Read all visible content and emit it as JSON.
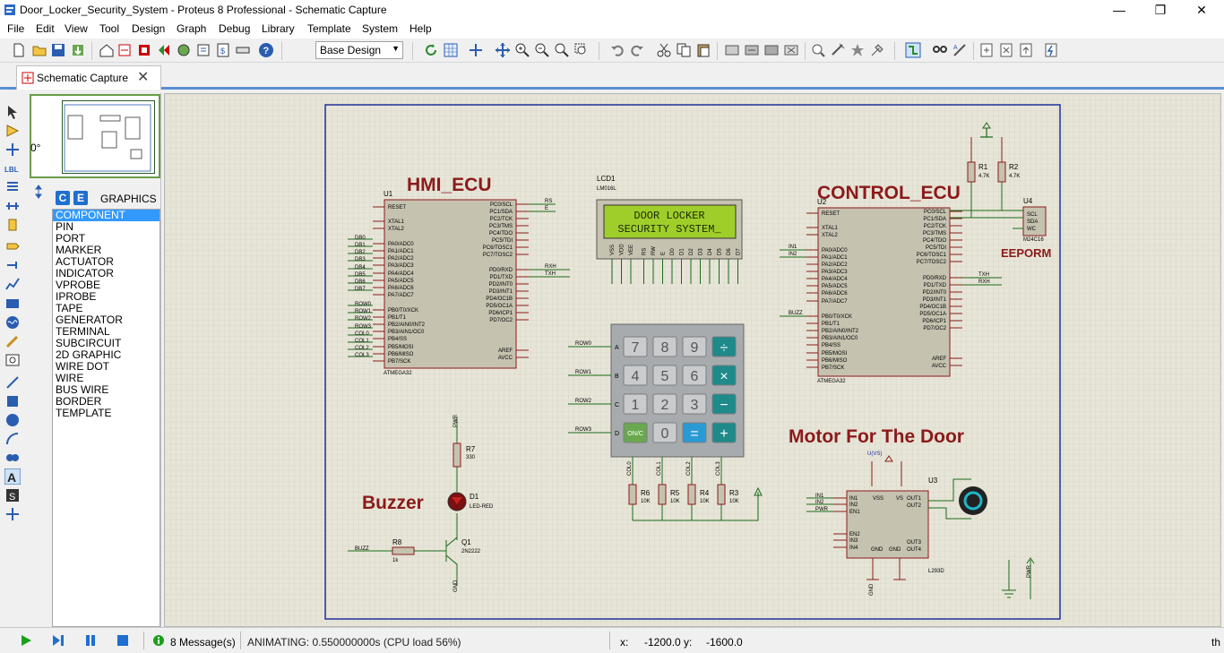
{
  "window": {
    "title": "Door_Locker_Security_System - Proteus 8 Professional - Schematic Capture",
    "minimize": "—",
    "restore": "❐",
    "close": "✕"
  },
  "menu": [
    "File",
    "Edit",
    "View",
    "Tool",
    "Design",
    "Graph",
    "Debug",
    "Library",
    "Template",
    "System",
    "Help"
  ],
  "toolbar": {
    "design_select": "Base Design",
    "accent_color": "#1e6fd0"
  },
  "tab": {
    "label": "Schematic Capture",
    "close": "✕"
  },
  "left_panel": {
    "rotation": "0°",
    "mode_tab_c": "C",
    "mode_tab_e": "E",
    "graphics_label": "GRAPHICS",
    "modes": [
      "COMPONENT",
      "PIN",
      "PORT",
      "MARKER",
      "ACTUATOR",
      "INDICATOR",
      "VPROBE",
      "IPROBE",
      "TAPE",
      "GENERATOR",
      "TERMINAL",
      "SUBCIRCUIT",
      "2D GRAPHIC",
      "WIRE DOT",
      "WIRE",
      "BUS WIRE",
      "BORDER",
      "TEMPLATE"
    ],
    "selected_mode": "COMPONENT"
  },
  "schematic": {
    "hmi_title": "HMI_ECU",
    "control_title": "CONTROL_ECU",
    "buzzer_title": "Buzzer",
    "motor_title": "Motor For The Door",
    "eeprom_title": "EEPORM",
    "u1_ref": "U1",
    "u1_part": "ATMEGA32",
    "u2_ref": "U2",
    "u2_part": "ATMEGA32",
    "u3_ref": "U3",
    "u3_part": "L293D",
    "u4_ref": "U4",
    "u4_part": "M24C16",
    "lcd_ref": "LCD1",
    "lcd_part": "LM016L",
    "lcd_line1": "DOOR LOCKER",
    "lcd_line2": "SECURITY SYSTEM_",
    "r1": "R1",
    "r1_val": "4.7K",
    "r2": "R2",
    "r2_val": "4.7K",
    "r3": "R3",
    "r3_val": "10K",
    "r4": "R4",
    "r4_val": "10K",
    "r5": "R5",
    "r5_val": "10K",
    "r6": "R6",
    "r6_val": "10K",
    "r7": "R7",
    "r7_val": "330",
    "r8": "R8",
    "r8_val": "1k",
    "d1": "D1",
    "d1_part": "LED-RED",
    "q1": "Q1",
    "q1_part": "2N2222",
    "u1_left_pins": [
      "RESET",
      "XTAL1",
      "XTAL2",
      "PA0/ADC0",
      "PA1/ADC1",
      "PA2/ADC2",
      "PA3/ADC3",
      "PA4/ADC4",
      "PA5/ADC5",
      "PA6/ADC6",
      "PA7/ADC7",
      "PB0/T0/XCK",
      "PB1/T1",
      "PB2/AIN0/INT2",
      "PB3/AIN1/OC0",
      "PB4/SS",
      "PB5/MOSI",
      "PB6/MISO",
      "PB7/SCK"
    ],
    "u1_right_pins": [
      "PC0/SCL",
      "PC1/SDA",
      "PC2/TCK",
      "PC3/TMS",
      "PC4/TDO",
      "PC5/TDI",
      "PC6/TOSC1",
      "PC7/TOSC2",
      "PD0/RXD",
      "PD1/TXD",
      "PD2/INT0",
      "PD3/INT1",
      "PD4/OC1B",
      "PD5/OC1A",
      "PD6/ICP1",
      "PD7/OC2",
      "AREF",
      "AVCC"
    ],
    "u1_nets": [
      "DB0",
      "DB1",
      "DB2",
      "DB3",
      "DB4",
      "DB5",
      "DB6",
      "DB7",
      "ROW0",
      "ROW1",
      "ROW2",
      "ROW3",
      "COL0",
      "COL1",
      "COL2",
      "COL3"
    ],
    "keypad_keys": [
      "7",
      "8",
      "9",
      "÷",
      "4",
      "5",
      "6",
      "×",
      "1",
      "2",
      "3",
      "−",
      "ON/C",
      "0",
      "=",
      "+"
    ],
    "keypad_rows": [
      "A",
      "B",
      "C",
      "D"
    ],
    "keypad_row_nets": [
      "ROW0",
      "ROW1",
      "ROW2",
      "ROW3"
    ],
    "keypad_cols": [
      "COL0",
      "COL1",
      "COL2",
      "COL3"
    ],
    "u2_left_nets": [
      "IN1",
      "IN2",
      "BUZZ"
    ],
    "u2_right_nets": [
      "TXH",
      "RXH"
    ],
    "u1_uart_nets": [
      "RXH",
      "TXH",
      "RS",
      "E"
    ],
    "l293_left": [
      "IN1",
      "IN2",
      "EN1",
      "EN2",
      "IN3",
      "IN4"
    ],
    "l293_nets": [
      "IN1",
      "IN2",
      "PWR"
    ],
    "l293_right": [
      "VSS",
      "VS",
      "OUT1",
      "OUT2",
      "GND",
      "GND",
      "OUT3",
      "OUT4"
    ],
    "buzz_net": "BUZZ",
    "pwr_label": "PWR",
    "gnd_label": "GND",
    "vss_label": "U(VS)"
  },
  "status": {
    "messages": "8 Message(s)",
    "animating": "ANIMATING: 0.550000000s (CPU load 56%)",
    "x_label": "x:",
    "x_value": "-1200.0",
    "y_label": "y:",
    "y_value": "-1600.0",
    "units": "th"
  }
}
